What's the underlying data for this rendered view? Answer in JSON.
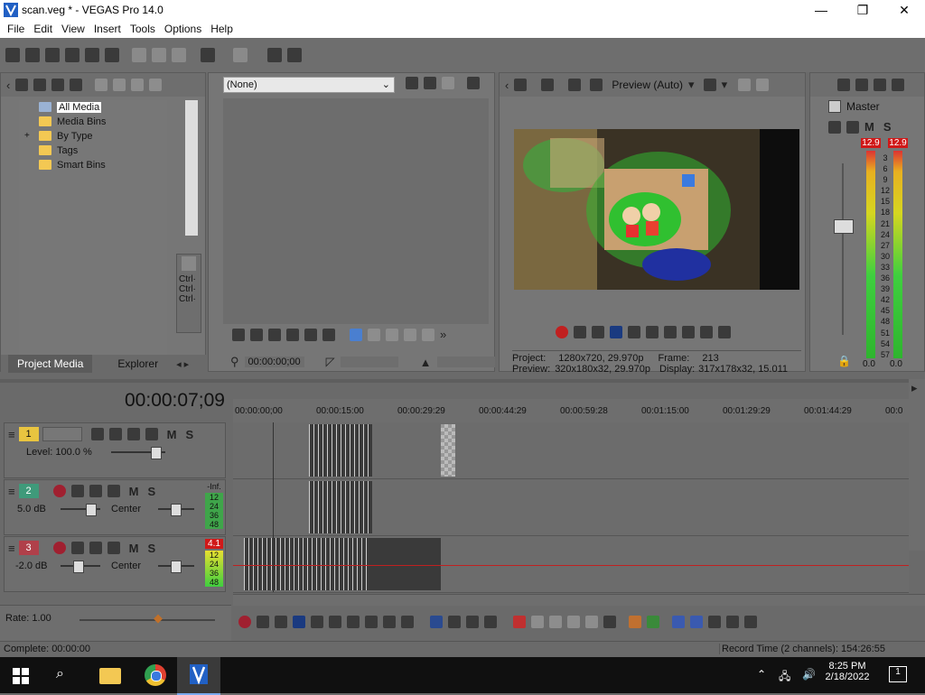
{
  "window": {
    "title": "scan.veg * - VEGAS Pro 14.0",
    "minimize": "—",
    "maximize": "❐",
    "close": "✕"
  },
  "menu": [
    "File",
    "Edit",
    "View",
    "Insert",
    "Tools",
    "Options",
    "Help"
  ],
  "project_media": {
    "tree": [
      "All Media",
      "Media Bins",
      "By Type",
      "Tags",
      "Smart Bins"
    ],
    "expander": "+",
    "tabs": [
      "Project Media",
      "Explorer"
    ],
    "ctrl_labels": [
      "Ctrl·",
      "Ctrl·",
      "Ctrl·"
    ]
  },
  "trimmer": {
    "source": "(None)",
    "timecode": "00:00:00;00"
  },
  "preview": {
    "quality": "Preview (Auto)",
    "project_label": "Project:",
    "project_value": "1280x720, 29.970p",
    "preview_label": "Preview:",
    "preview_value": "320x180x32, 29.970p",
    "frame_label": "Frame:",
    "frame_value": "213",
    "display_label": "Display:",
    "display_value": "317x178x32, 15.011"
  },
  "master": {
    "title": "Master",
    "peak_left": "12.9",
    "peak_right": "12.9",
    "scale": [
      "3",
      "6",
      "9",
      "12",
      "15",
      "18",
      "21",
      "24",
      "27",
      "30",
      "33",
      "36",
      "39",
      "42",
      "45",
      "48",
      "51",
      "54",
      "57"
    ],
    "bottom_left": "0.0",
    "bottom_right": "0.0"
  },
  "timeline": {
    "timecode": "00:00:07;09",
    "ruler": [
      "00:00:00;00",
      "00:00:15:00",
      "00:00:29:29",
      "00:00:44:29",
      "00:00:59:28",
      "00:01:15:00",
      "00:01:29:29",
      "00:01:44:29",
      "00:0"
    ],
    "tracks": [
      {
        "num": "1",
        "type": "video",
        "level": "Level: 100.0 %"
      },
      {
        "num": "2",
        "type": "audio",
        "vol": "5.0 dB",
        "pan": "Center",
        "meter_top": "-Inf.",
        "meter_vals": [
          "12",
          "24",
          "36",
          "48"
        ]
      },
      {
        "num": "3",
        "type": "audio",
        "vol": "-2.0 dB",
        "pan": "Center",
        "meter_top": "4.1",
        "meter_vals": [
          "12",
          "24",
          "36",
          "48"
        ]
      }
    ],
    "rate": "Rate: 1.00"
  },
  "status": {
    "left": "Complete: 00:00:00",
    "right": "Record Time (2 channels): 154:26:55"
  },
  "taskbar": {
    "time": "8:25 PM",
    "date": "2/18/2022",
    "notification": "1"
  },
  "colors": {
    "track_video": "#e8c440",
    "track_audio2": "#3f9a7a",
    "track_audio3": "#b0404a",
    "selection_blue": "#4a7fd0"
  }
}
